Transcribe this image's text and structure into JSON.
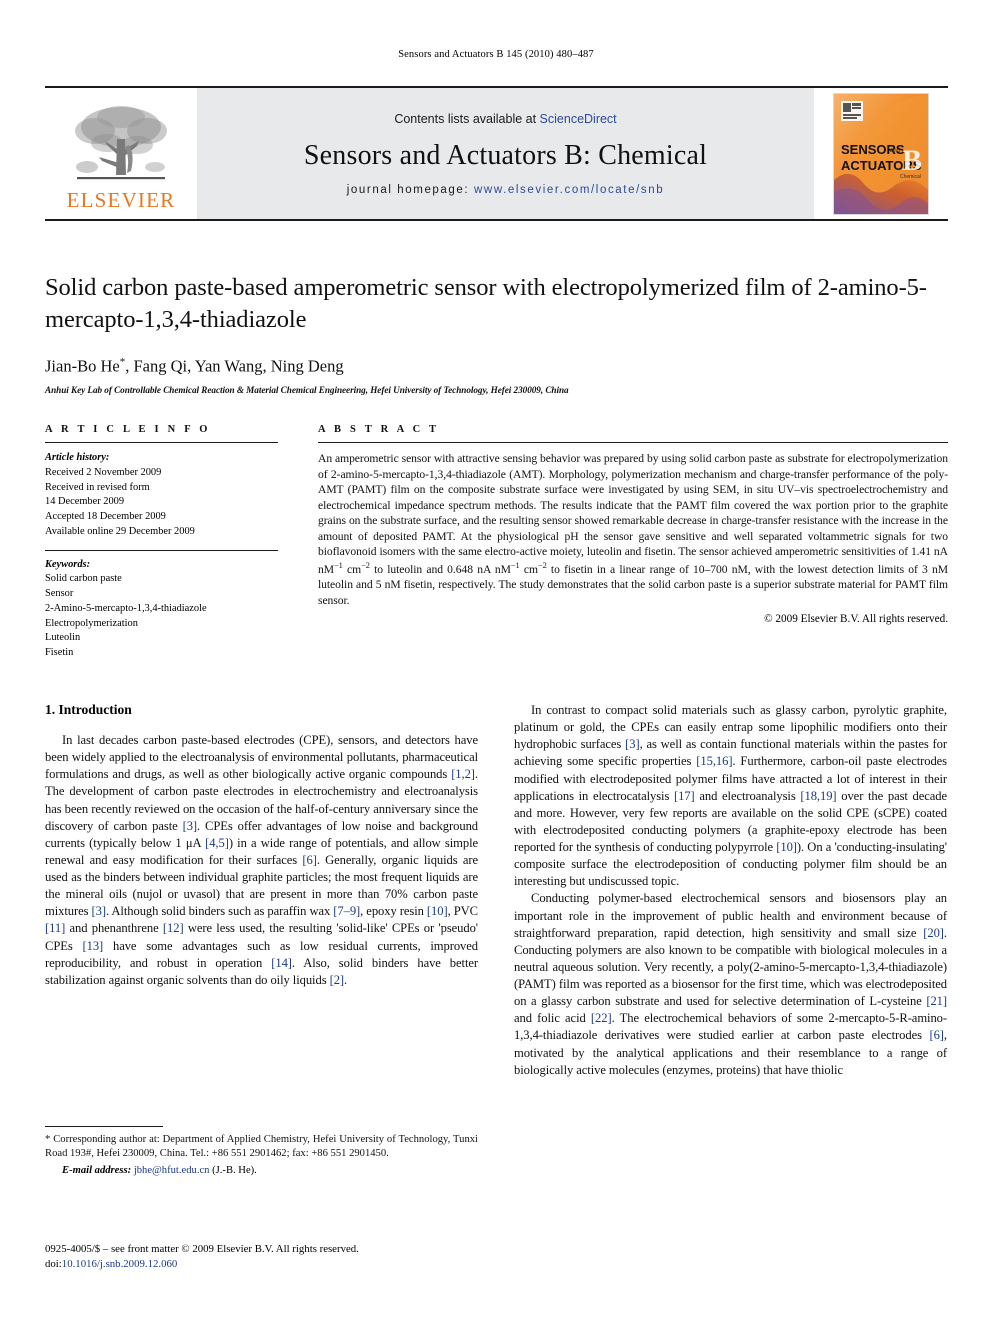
{
  "running_head": "Sensors and Actuators B 145 (2010) 480–487",
  "masthead": {
    "publisher_logo_text": "ELSEVIER",
    "contents_prefix": "Contents lists available at ",
    "contents_link": "ScienceDirect",
    "journal_name": "Sensors and Actuators B: Chemical",
    "homepage_prefix": "journal homepage: ",
    "homepage_url": "www.elsevier.com/locate/snb",
    "cover": {
      "line1": "SENSORS",
      "line1_small": "and",
      "line2": "ACTUATORS",
      "letter": "B",
      "letter_sub": "Chemical"
    },
    "colors": {
      "band_background": "#e8e9ea",
      "link_blue": "#2b4a9b",
      "elsevier_orange": "#E87722",
      "cover_orange": "#F28C28"
    }
  },
  "title": "Solid carbon paste-based amperometric sensor with electropolymerized film of 2-amino-5-mercapto-1,3,4-thiadiazole",
  "authors": "Jian-Bo He*, Fang Qi, Yan Wang, Ning Deng",
  "affiliation": "Anhui Key Lab of Controllable Chemical Reaction & Material Chemical Engineering, Hefei University of Technology, Hefei 230009, China",
  "article_info": {
    "heading": "A R T I C L E  I N F O",
    "history_label": "Article history:",
    "history": [
      "Received 2 November 2009",
      "Received in revised form",
      "14 December 2009",
      "Accepted 18 December 2009",
      "Available online 29 December 2009"
    ],
    "keywords_label": "Keywords:",
    "keywords": [
      "Solid carbon paste",
      "Sensor",
      "2-Amino-5-mercapto-1,3,4-thiadiazole",
      "Electropolymerization",
      "Luteolin",
      "Fisetin"
    ]
  },
  "abstract": {
    "heading": "A B S T R A C T",
    "text": "An amperometric sensor with attractive sensing behavior was prepared by using solid carbon paste as substrate for electropolymerization of 2-amino-5-mercapto-1,3,4-thiadiazole (AMT). Morphology, polymerization mechanism and charge-transfer performance of the poly-AMT (PAMT) film on the composite substrate surface were investigated by using SEM, in situ UV–vis spectroelectrochemistry and electrochemical impedance spectrum methods. The results indicate that the PAMT film covered the wax portion prior to the graphite grains on the substrate surface, and the resulting sensor showed remarkable decrease in charge-transfer resistance with the increase in the amount of deposited PAMT. At the physiological pH the sensor gave sensitive and well separated voltammetric signals for two bioflavonoid isomers with the same electro-active moiety, luteolin and fisetin. The sensor achieved amperometric sensitivities of 1.41 nA nM−1 cm−2 to luteolin and 0.648 nA nM−1 cm−2 to fisetin in a linear range of 10–700 nM, with the lowest detection limits of 3 nM luteolin and 5 nM fisetin, respectively. The study demonstrates that the solid carbon paste is a superior substrate material for PAMT film sensor.",
    "copyright": "© 2009 Elsevier B.V. All rights reserved."
  },
  "body": {
    "section_number_title": "1. Introduction",
    "left_paragraph_1": "In last decades carbon paste-based electrodes (CPE), sensors, and detectors have been widely applied to the electroanalysis of environmental pollutants, pharmaceutical formulations and drugs, as well as other biologically active organic compounds [1,2]. The development of carbon paste electrodes in electrochemistry and electroanalysis has been recently reviewed on the occasion of the half-of-century anniversary since the discovery of carbon paste [3]. CPEs offer advantages of low noise and background currents (typically below 1 μA [4,5]) in a wide range of potentials, and allow simple renewal and easy modification for their surfaces [6]. Generally, organic liquids are used as the binders between individual graphite particles; the most frequent liquids are the mineral oils (nujol or uvasol) that are present in more than 70% carbon paste mixtures [3]. Although solid binders such as paraffin wax [7–9], epoxy resin [10], PVC [11] and phenanthrene [12] were less used, the resulting 'solid-like' CPEs or 'pseudo' CPEs [13] have some advantages such as low residual currents, improved reproducibility, and robust in operation [14]. Also, solid binders have better stabilization against organic solvents than do oily liquids [2].",
    "right_paragraph_1": "In contrast to compact solid materials such as glassy carbon, pyrolytic graphite, platinum or gold, the CPEs can easily entrap some lipophilic modifiers onto their hydrophobic surfaces [3], as well as contain functional materials within the pastes for achieving some specific properties [15,16]. Furthermore, carbon-oil paste electrodes modified with electrodeposited polymer films have attracted a lot of interest in their applications in electrocatalysis [17] and electroanalysis [18,19] over the past decade and more. However, very few reports are available on the solid CPE (sCPE) coated with electrodeposited conducting polymers (a graphite-epoxy electrode has been reported for the synthesis of conducting polypyrrole [10]). On a 'conducting-insulating' composite surface the electrodeposition of conducting polymer film should be an interesting but undiscussed topic.",
    "right_paragraph_2": "Conducting polymer-based electrochemical sensors and biosensors play an important role in the improvement of public health and environment because of straightforward preparation, rapid detection, high sensitivity and small size [20]. Conducting polymers are also known to be compatible with biological molecules in a neutral aqueous solution. Very recently, a poly(2-amino-5-mercapto-1,3,4-thiadiazole) (PAMT) film was reported as a biosensor for the first time, which was electrodeposited on a glassy carbon substrate and used for selective determination of L-cysteine [21] and folic acid [22]. The electrochemical behaviors of some 2-mercapto-5-R-amino-1,3,4-thiadiazole derivatives were studied earlier at carbon paste electrodes [6], motivated by the analytical applications and their resemblance to a range of biologically active molecules (enzymes, proteins) that have thiolic"
  },
  "footnotes": {
    "corresponding": "* Corresponding author at: Department of Applied Chemistry, Hefei University of Technology, Tunxi Road 193#, Hefei 230009, China. Tel.: +86 551 2901462; fax: +86 551 2901450.",
    "email_label": "E-mail address: ",
    "email": "jbhe@hfut.edu.cn",
    "email_suffix": " (J.-B. He).",
    "frontmatter": "0925-4005/$ – see front matter © 2009 Elsevier B.V. All rights reserved.",
    "doi_label": "doi:",
    "doi": "10.1016/j.snb.2009.12.060"
  }
}
